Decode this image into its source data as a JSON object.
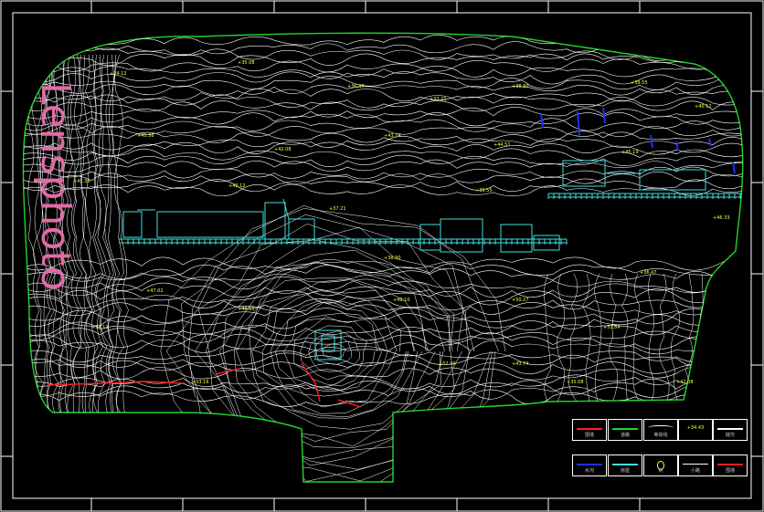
{
  "drawing": {
    "colors": {
      "background": "#000000",
      "frame": "#ffffff",
      "boundary": "#1ed62a",
      "contour": "#ffffff",
      "elevation_label": "#ffff44",
      "building": "#3fe0e0",
      "wall": "#ff2020",
      "water": "#2030ff",
      "watermark": "#e26aa8"
    },
    "watermark": "Lensphoto",
    "elevation_labels": [
      "+34.12",
      "+35.08",
      "+36.47",
      "+37.21",
      "+38.90",
      "+39.55",
      "+40.12",
      "+41.36",
      "+42.08",
      "+43.74",
      "+44.51",
      "+45.19",
      "+46.33",
      "+47.02",
      "+48.65",
      "+49.10",
      "+50.27",
      "+51.84",
      "+52.40",
      "+53.16"
    ],
    "legend": [
      {
        "label": "围墙",
        "glyph": "red-line"
      },
      {
        "label": "道路",
        "glyph": "green-line"
      },
      {
        "label": "等高线",
        "glyph": "contour"
      },
      {
        "label": "+34.43",
        "glyph": "elevation"
      },
      {
        "label": "陡坎",
        "glyph": "white-line"
      },
      {
        "label": "水沟",
        "glyph": "blue-line"
      },
      {
        "label": "房屋",
        "glyph": "cyan-line"
      },
      {
        "label": "树",
        "glyph": "tree"
      },
      {
        "label": "小路",
        "glyph": "thin-line"
      },
      {
        "label": "围墙",
        "glyph": "red-line"
      }
    ]
  }
}
